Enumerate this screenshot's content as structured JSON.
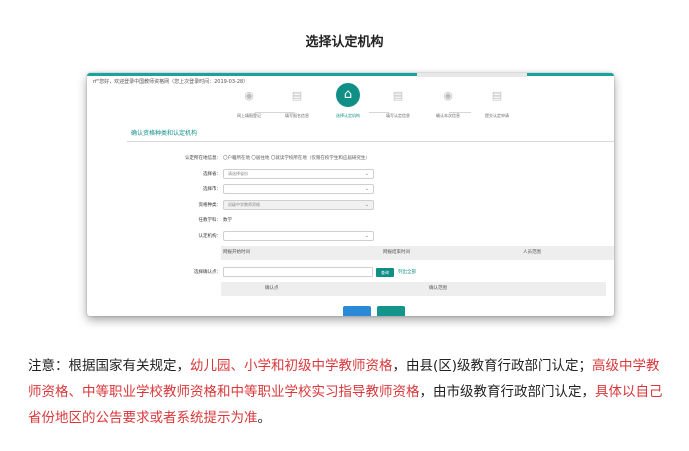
{
  "heading": "选择认定机构",
  "screenshot": {
    "welcome": "rf\"您好，欢迎登录中国教师资格网（您上次登录时间：2019-03-28）",
    "steps": [
      {
        "label": "网上填报登记",
        "icon": "eye-icon"
      },
      {
        "label": "填写报名信息",
        "icon": "document-icon"
      },
      {
        "label": "选择认定机构",
        "icon": "institution-icon",
        "active": true
      },
      {
        "label": "填写认定信息",
        "icon": "document-icon"
      },
      {
        "label": "确认本次信息",
        "icon": "eye-icon"
      },
      {
        "label": "提交认定申请",
        "icon": "document-icon"
      }
    ],
    "section_title": "确认资格种类和认定机构",
    "form": {
      "location_label": "认定所在地信息：",
      "location_options": "〇户籍所在地  〇居住地  〇就读学校所在地（仅限在校学生和应届研究生）",
      "province_label": "选择省：",
      "province_value": "请选择省份",
      "city_label": "选择市：",
      "city_value": "",
      "cert_type_label": "资格种类：",
      "cert_type_value": "初级中学教师资格",
      "subject_label": "任教学科：",
      "subject_value": "数学",
      "agency_label": "认定机构：",
      "agency_value": ""
    },
    "table1_headers": [
      "网报开始时间",
      "网报结束时间",
      "人员范围"
    ],
    "confirm_label": "选择确认点：",
    "query_button": "查询",
    "list_all_link": "列出全部",
    "table2_headers": [
      "确认点",
      "确认范围"
    ]
  },
  "note": {
    "prefix": "注意：根据国家有关规定，",
    "red1": "幼儿园、小学和初级中学教师资格",
    "mid1": "，由县(区)级教育行政部门认定；",
    "red2": "高级中学教师资格、中等职业学校教师资格和中等职业学校实习指导教师资格",
    "mid2": "，由市级教育行政部门认定，",
    "red3": "具体以自己省份地区的公告要求或者系统提示为准",
    "suffix": "。"
  }
}
